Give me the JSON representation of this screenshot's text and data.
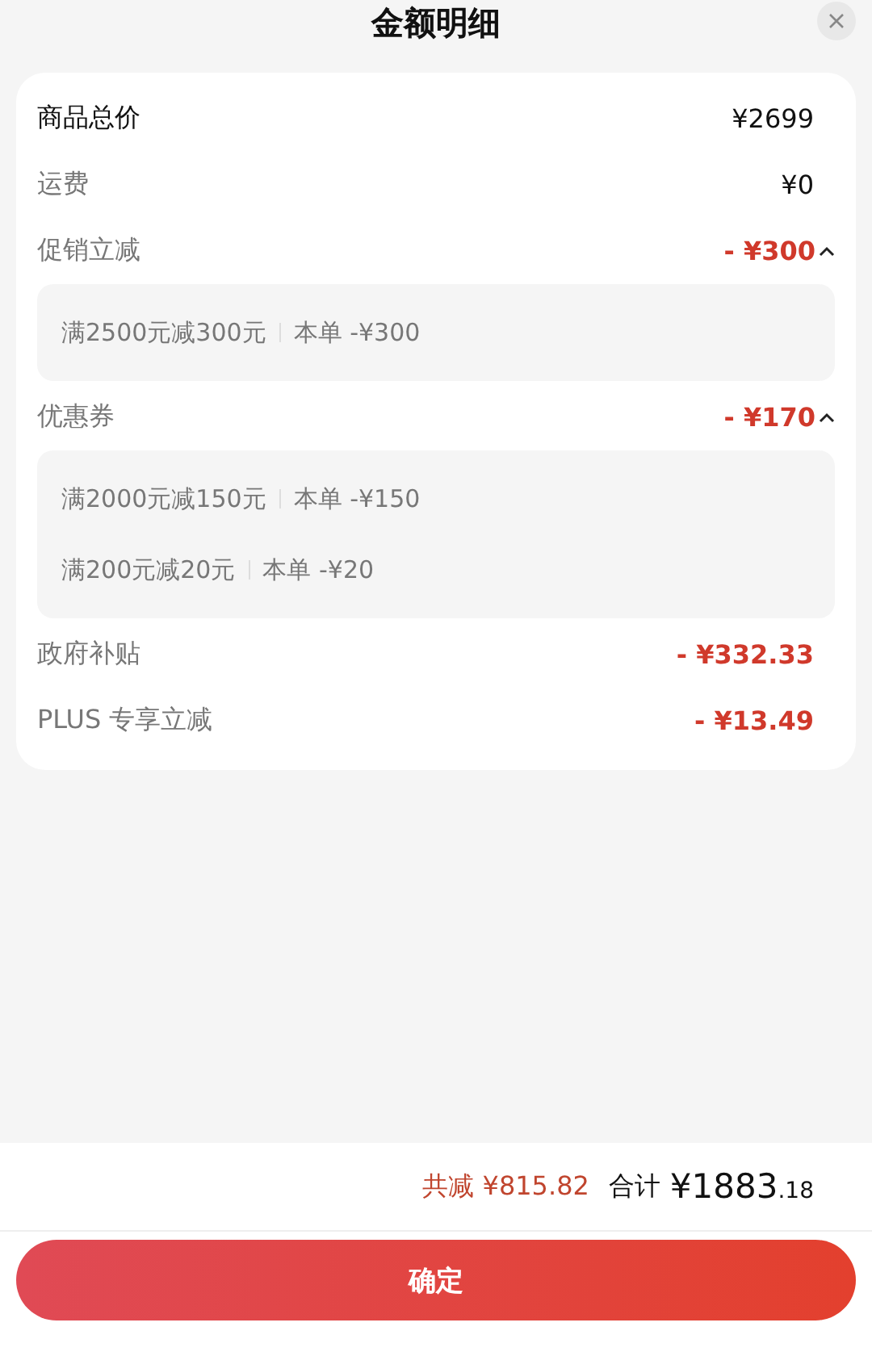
{
  "header": {
    "title": "金额明细"
  },
  "rows": [
    {
      "kind": "total",
      "label": "商品总价",
      "amount": "¥2699"
    },
    {
      "kind": "fee",
      "label": "运费",
      "amount": "¥0"
    },
    {
      "kind": "discount",
      "label": "促销立减",
      "amount": "- ¥300",
      "expanded": true,
      "details": [
        {
          "rule": "满2500元减300元",
          "saving": "本单 -¥300"
        }
      ]
    },
    {
      "kind": "discount",
      "label": "优惠券",
      "amount": "- ¥170",
      "expanded": true,
      "details": [
        {
          "rule": "满2000元减150元",
          "saving": "本单 -¥150"
        },
        {
          "rule": "满200元减20元",
          "saving": "本单 -¥20"
        }
      ]
    },
    {
      "kind": "discount",
      "label": "政府补贴",
      "amount": "- ¥332.33"
    },
    {
      "kind": "discount",
      "label": "PLUS 专享立减",
      "amount": "- ¥13.49"
    }
  ],
  "summary": {
    "saved_label": "共减",
    "saved_amount": "¥815.82",
    "total_label": "合计",
    "total_main": "¥1883",
    "total_cents": ".18"
  },
  "confirm_button": "确定"
}
